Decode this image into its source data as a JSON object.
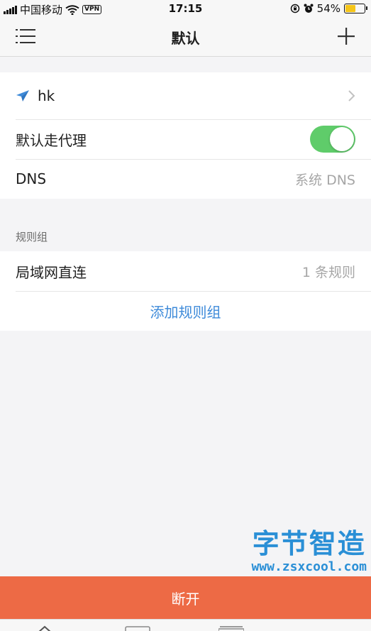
{
  "status_bar": {
    "carrier": "中国移动",
    "vpn_badge": "VPN",
    "time": "17:15",
    "battery_text": "54%",
    "battery_level": 0.54
  },
  "nav": {
    "title": "默认",
    "menu_icon": "menu-list-icon",
    "add_icon": "plus-icon"
  },
  "server": {
    "name": "hk",
    "icon": "paper-plane-icon"
  },
  "settings": {
    "default_proxy_label": "默认走代理",
    "default_proxy_on": true,
    "dns_label": "DNS",
    "dns_value": "系统 DNS"
  },
  "rule_groups": {
    "section_label": "规则组",
    "items": [
      {
        "label": "局域网直连",
        "value": "1 条规则"
      }
    ],
    "add_label": "添加规则组"
  },
  "watermark": {
    "title": "字节智造",
    "url": "www.zsxcool.com"
  },
  "action": {
    "disconnect_label": "断开",
    "color": "#ed6a45"
  },
  "colors": {
    "accent_blue": "#3d8ad9",
    "toggle_green": "#5fcc6a"
  }
}
